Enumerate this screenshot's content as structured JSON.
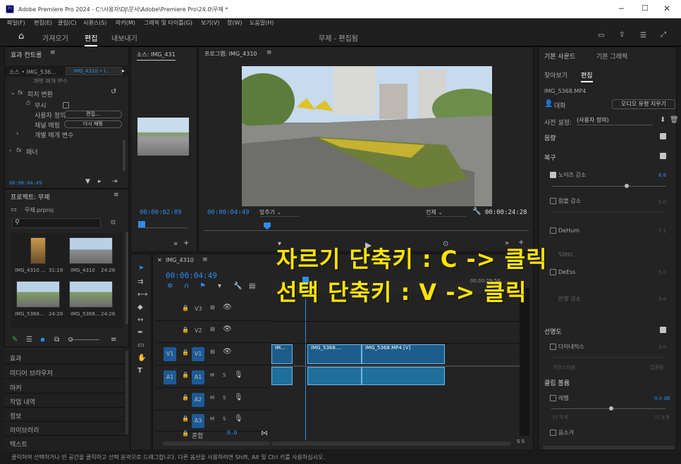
{
  "window": {
    "title": "Adobe Premiere Pro 2024 - C:\\사용자\\DJ\\문서\\Adobe\\Premiere Pro\\24.0\\무제 *"
  },
  "menu": [
    "파일(F)",
    "편집(E)",
    "클립(C)",
    "시퀀스(S)",
    "마커(M)",
    "그래픽 및 타이틀(G)",
    "보기(V)",
    "창(W)",
    "도움말(H)"
  ],
  "workspace": {
    "tabs": [
      "가져오기",
      "편집",
      "내보내기"
    ],
    "active": "편집",
    "center_title": "무제 - 편집됨"
  },
  "effect_controls": {
    "title": "효과 컨트롤",
    "source": "소스 • IMG_536...",
    "clip": "IMG_4310 • I...",
    "cut_row": "개별 매개 변수",
    "fx_name": "피치 변환",
    "bypass": "무시",
    "user_label": "사용자 정의",
    "edit_btn": "편집...",
    "channel_label": "채널 매핑",
    "reset_btn": "다시 매핑",
    "param_row": "개별 매개 변수",
    "panner": "패너",
    "timecode": "00:00:04:49"
  },
  "project": {
    "title": "프로젝트: 무제",
    "file": "무제.prproj",
    "items": [
      {
        "name": "IMG_4310 ...",
        "dur": "31:19"
      },
      {
        "name": "IMG_4310",
        "dur": "24:28"
      },
      {
        "name": "IMG_5368...",
        "dur": "24:28"
      },
      {
        "name": "IMG_5368...",
        "dur": "24:28"
      }
    ],
    "sidebar_items": [
      "효과",
      "미디어 브라우저",
      "마커",
      "작업 내역",
      "정보",
      "라이브러리",
      "텍스트"
    ]
  },
  "source_monitor": {
    "tab": "소스: IMG_431",
    "timecode": "00:00:02:09"
  },
  "program_monitor": {
    "tab": "프로그램: IMG_4310",
    "timecode": "00:00:04:49",
    "fit": "맞추기",
    "quality": "전체",
    "duration": "00:00:24:28"
  },
  "timeline": {
    "tab": "IMG_4310",
    "timecode": "00:00:04:49",
    "ruler_time": "00:00:29:58",
    "tracks_video": [
      "V3",
      "V2",
      "V1"
    ],
    "tracks_audio": [
      "A1",
      "A2",
      "A3"
    ],
    "src_v": "V1",
    "src_a": "A1",
    "mix_label": "혼합",
    "mix_value": "0.0",
    "clips_video": [
      "IM...",
      "IMG_5368....",
      "IMG_5368.MP4 [V]"
    ],
    "meter_s": "S  S"
  },
  "essential_sound": {
    "tabs": [
      "기본 사운드",
      "기본 그래픽"
    ],
    "subtabs": [
      "찾아보기",
      "편집"
    ],
    "clip_name": "IMG_5368.MP4",
    "dialogue": "대화",
    "clear_btn": "오디오 유형 지우기",
    "preset_label": "사전 설정:",
    "preset_value": "(사용자 정의)",
    "loudness": "음량",
    "repair": "복구",
    "noise": "노이즈 감소",
    "noise_val": "6.6",
    "rumble": "럼블 감소",
    "rumble_val": "5.0",
    "dehum": "DeHum",
    "dehum_val": "7.1",
    "hz": "50Hz",
    "deess": "DeEss",
    "deess_val": "5.0",
    "reverb": "반향 감소",
    "reverb_val": "5.0",
    "clarity": "선명도",
    "dynamics": "다이내믹스",
    "dyn_val": "3.0",
    "natural": "자연스러움",
    "focused": "집중됨",
    "clip_vol": "클립 볼륨",
    "level": "레벨",
    "level_val": "0.0 dB",
    "quieter": "더 작게",
    "louder": "더 크게",
    "mute": "음소거"
  },
  "overlay": {
    "line1": "자르기 단축키 : C -> 클릭",
    "line2": "선택 단축키 : V -> 클릭"
  },
  "status": "클릭하여 선택하거나 빈 공간을 클릭하고 선택 윤곽으로 드래그합니다. 다른 옵션을 사용하려면 Shift, Alt 및 Ctrl 키를 사용하십시오."
}
